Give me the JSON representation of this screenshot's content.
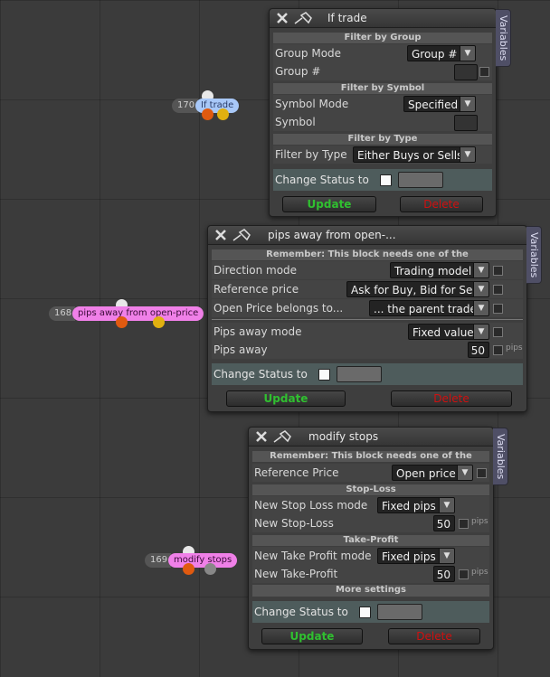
{
  "colors": {
    "update": "#30c030",
    "delete": "#d01010",
    "status_bg": "#4e5c5c",
    "vars_tab": "#4f4f66",
    "node_blue": "#a8c8f8",
    "node_pink": "#f080e8",
    "dot_orange": "#e05a10",
    "dot_yellow": "#e0b010",
    "dot_gray": "#888888",
    "dot_white": "#e8e8e8"
  },
  "panel_if_trade": {
    "title": "If trade",
    "variables_tab": "Variables",
    "sections": {
      "group": "Filter by Group",
      "symbol": "Filter by Symbol",
      "type": "Filter by Type"
    },
    "rows": {
      "group_mode_label": "Group Mode",
      "group_mode_value": "Group #",
      "group_num_label": "Group #",
      "symbol_mode_label": "Symbol Mode",
      "symbol_mode_value": "Specified",
      "symbol_label": "Symbol",
      "filter_type_label": "Filter by Type",
      "filter_type_value": "Either Buys or Sells"
    },
    "status_label": "Change Status to",
    "update_label": "Update",
    "delete_label": "Delete",
    "icons": [
      "close-icon",
      "pin-icon",
      "dropdown-arrow-icon"
    ]
  },
  "panel_pips_away": {
    "title": "pips away from open-...",
    "variables_tab": "Variables",
    "sections": {
      "remember": "Remember: This block needs one of the"
    },
    "rows": {
      "direction_label": "Direction mode",
      "direction_value": "Trading model",
      "reference_label": "Reference price",
      "reference_value": "Ask for Buy, Bid for Sell",
      "open_price_label": "Open Price belongs to...",
      "open_price_value": "... the parent trade",
      "pips_mode_label": "Pips away mode",
      "pips_mode_value": "Fixed value",
      "pips_away_label": "Pips away",
      "pips_away_value": "50",
      "pips_unit": "pips"
    },
    "status_label": "Change Status to",
    "update_label": "Update",
    "delete_label": "Delete"
  },
  "panel_modify_stops": {
    "title": "modify stops",
    "variables_tab": "Variables",
    "sections": {
      "remember": "Remember: This block needs one of the",
      "stop_loss": "Stop-Loss",
      "take_profit": "Take-Profit",
      "more_settings": "More settings"
    },
    "rows": {
      "reference_label": "Reference Price",
      "reference_value": "Open price",
      "sl_mode_label": "New Stop Loss mode",
      "sl_mode_value": "Fixed pips",
      "sl_label": "New Stop-Loss",
      "sl_value": "50",
      "tp_mode_label": "New Take Profit mode",
      "tp_mode_value": "Fixed pips",
      "tp_label": "New Take-Profit",
      "tp_value": "50",
      "pips_unit": "pips"
    },
    "status_label": "Change Status to",
    "update_label": "Update",
    "delete_label": "Delete"
  },
  "nodes": [
    {
      "id": "170",
      "label": "If trade"
    },
    {
      "id": "168",
      "label": "pips away from open-price"
    },
    {
      "id": "169",
      "label": "modify stops"
    }
  ]
}
